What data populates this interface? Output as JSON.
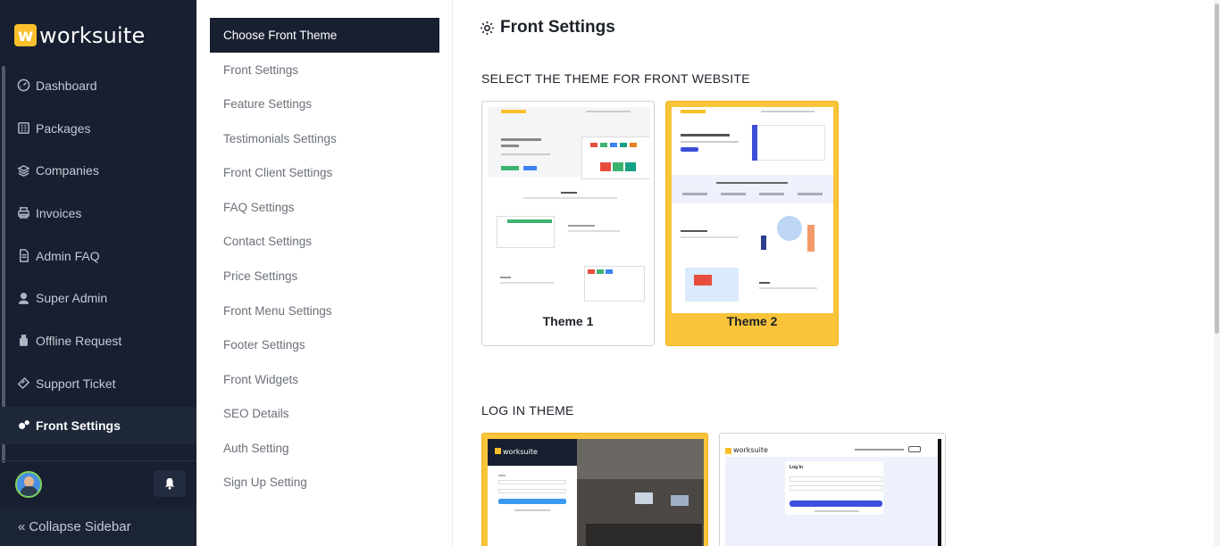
{
  "brand": {
    "logo_letter": "w",
    "name": "worksuite"
  },
  "sidebar": {
    "items": [
      {
        "label": "Dashboard",
        "icon": "dashboard-icon"
      },
      {
        "label": "Packages",
        "icon": "packages-icon"
      },
      {
        "label": "Companies",
        "icon": "layers-icon"
      },
      {
        "label": "Invoices",
        "icon": "printer-icon"
      },
      {
        "label": "Admin FAQ",
        "icon": "document-icon"
      },
      {
        "label": "Super Admin",
        "icon": "user-icon"
      },
      {
        "label": "Offline Request",
        "icon": "robot-icon"
      },
      {
        "label": "Support Ticket",
        "icon": "ticket-icon"
      },
      {
        "label": "Front Settings",
        "icon": "gears-icon",
        "active": true
      }
    ],
    "collapse_label": "Collapse Sidebar"
  },
  "settings_menu": {
    "items": [
      "Choose Front Theme",
      "Front Settings",
      "Feature Settings",
      "Testimonials Settings",
      "Front Client Settings",
      "FAQ Settings",
      "Contact Settings",
      "Price Settings",
      "Front Menu Settings",
      "Footer Settings",
      "Front Widgets",
      "SEO Details",
      "Auth Setting",
      "Sign Up Setting"
    ],
    "active_index": 0
  },
  "main": {
    "title": "Front Settings",
    "front_theme_section": "SELECT THE THEME FOR FRONT WEBSITE",
    "themes": [
      {
        "name": "Theme 1",
        "selected": false
      },
      {
        "name": "Theme 2",
        "selected": true
      }
    ],
    "login_theme_section": "LOG IN THEME",
    "login_themes": [
      {
        "selected": true,
        "brand": "worksuite"
      },
      {
        "selected": false,
        "brand": "worksuite",
        "heading": "Log In"
      }
    ]
  },
  "colors": {
    "sidebar_bg": "#171f30",
    "accent": "#f9c43a",
    "primary_blue": "#3b4fd8"
  }
}
